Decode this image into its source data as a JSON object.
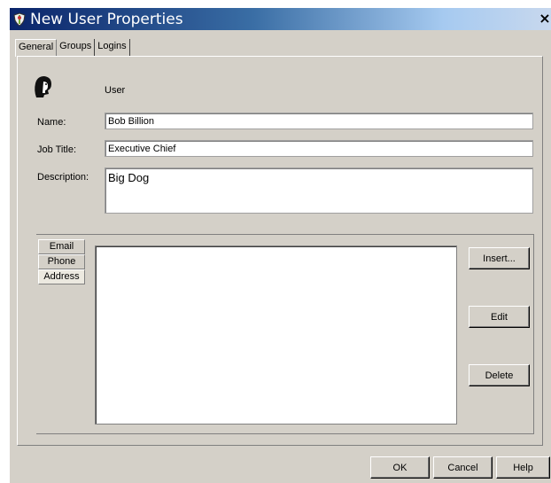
{
  "window": {
    "title": "New User Properties",
    "close_label": "×"
  },
  "tabs": [
    {
      "label": "General"
    },
    {
      "label": "Groups"
    },
    {
      "label": "Logins"
    }
  ],
  "general": {
    "type_label": "User",
    "name_label": "Name:",
    "name_value": "Bob Billion",
    "job_title_label": "Job Title:",
    "job_title_value": "Executive Chief",
    "description_label": "Description:",
    "description_value": "Big Dog"
  },
  "contact_tabs": [
    {
      "label": "Email"
    },
    {
      "label": "Phone"
    },
    {
      "label": "Address"
    }
  ],
  "contact_buttons": {
    "insert": "Insert...",
    "edit": "Edit",
    "delete": "Delete"
  },
  "footer": {
    "ok": "OK",
    "cancel": "Cancel",
    "help": "Help"
  },
  "icons": {
    "app": "app-shield-icon",
    "user": "user-head-icon"
  },
  "colors": {
    "titlebar_start": "#0a246a",
    "titlebar_end": "#a6caf0",
    "face": "#d4d0c8"
  }
}
